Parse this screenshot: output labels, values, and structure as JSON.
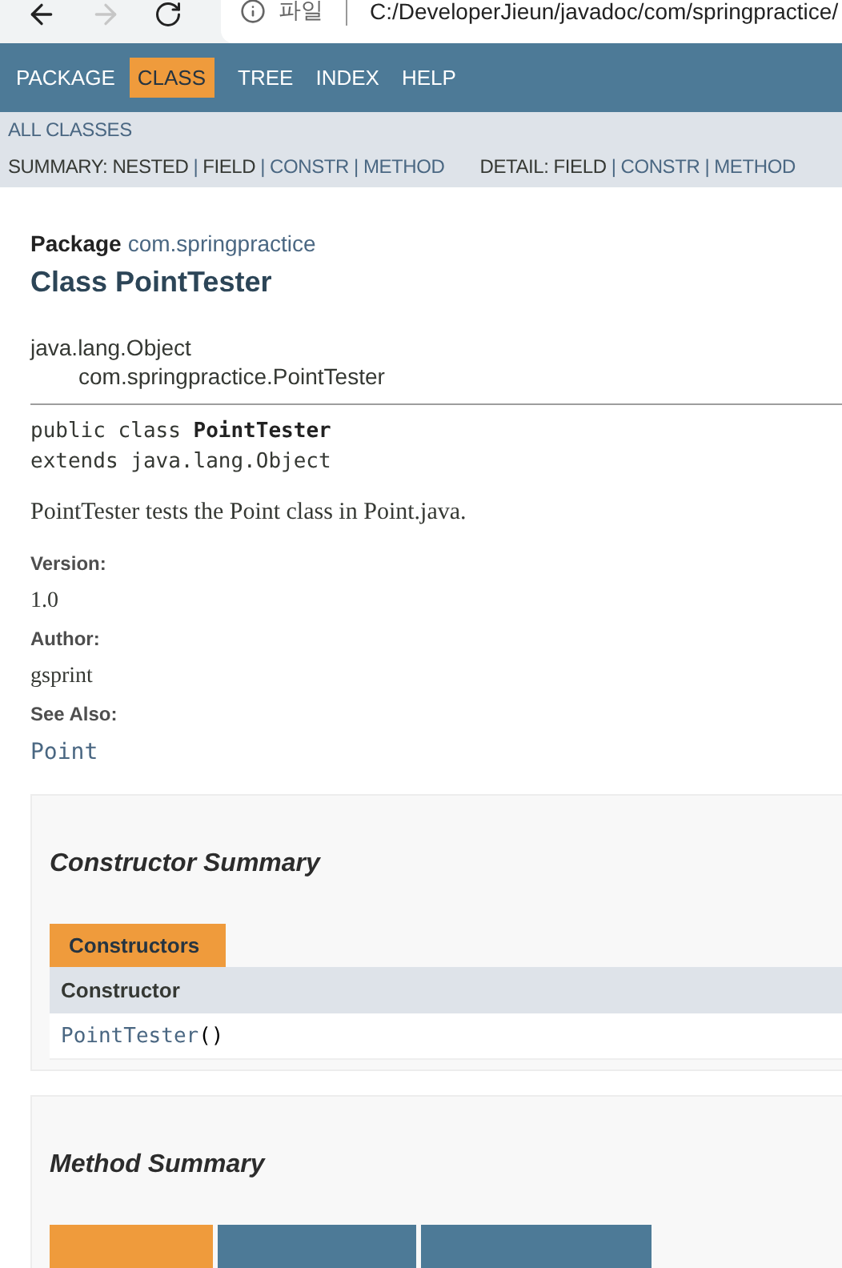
{
  "browser": {
    "back_disabled": false,
    "forward_disabled": true,
    "scheme_label": "파일",
    "url": "C:/DeveloperJieun/javadoc/com/springpractice/"
  },
  "nav": [
    {
      "label": "PACKAGE",
      "selected": false
    },
    {
      "label": "CLASS",
      "selected": true
    },
    {
      "label": "TREE",
      "selected": false
    },
    {
      "label": "INDEX",
      "selected": false
    },
    {
      "label": "HELP",
      "selected": false
    }
  ],
  "all_classes": "ALL CLASSES",
  "summary_nav": [
    {
      "kind": "label",
      "text": "SUMMARY:"
    },
    {
      "kind": "plain",
      "text": "NESTED"
    },
    {
      "kind": "separator",
      "text": "|"
    },
    {
      "kind": "plain",
      "text": "FIELD"
    },
    {
      "kind": "separator",
      "text": "|"
    },
    {
      "kind": "link",
      "text": "CONSTR"
    },
    {
      "kind": "separator",
      "text": "|"
    },
    {
      "kind": "link",
      "text": "METHOD"
    }
  ],
  "detail_nav": [
    {
      "kind": "label",
      "text": "DETAIL:"
    },
    {
      "kind": "plain",
      "text": "FIELD"
    },
    {
      "kind": "separator",
      "text": "|"
    },
    {
      "kind": "link",
      "text": "CONSTR"
    },
    {
      "kind": "separator",
      "text": "|"
    },
    {
      "kind": "link",
      "text": "METHOD"
    }
  ],
  "package_label": "Package",
  "package_name": "com.springpractice",
  "title": "Class PointTester",
  "inheritance": [
    {
      "text": "java.lang.Object"
    },
    {
      "text": "com.springpractice.PointTester"
    }
  ],
  "signature": {
    "prefix": "public class ",
    "name": "PointTester",
    "extends": "extends java.lang.Object"
  },
  "description": "PointTester tests the Point class in Point.java.",
  "tags": [
    {
      "label": "Version:",
      "value": "1.0",
      "kind": "text"
    },
    {
      "label": "Author:",
      "value": "gsprint",
      "kind": "text"
    },
    {
      "label": "See Also:",
      "value": "Point",
      "kind": "link"
    }
  ],
  "constructor_summary": {
    "title": "Constructor Summary",
    "tab": "Constructors",
    "column": "Constructor",
    "rows": [
      {
        "name": "PointTester",
        "params": "()"
      }
    ]
  },
  "method_summary": {
    "title": "Method Summary",
    "tabs": [
      {
        "selected": true
      },
      {
        "selected": false
      },
      {
        "selected": false
      }
    ]
  }
}
